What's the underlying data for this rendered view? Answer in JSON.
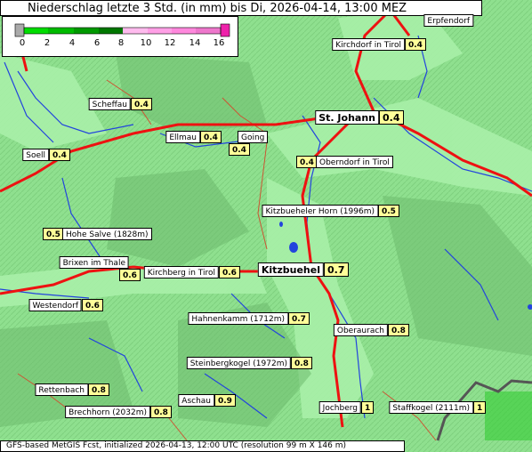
{
  "title": "Niederschlag letzte 3 Std. (in mm) bis Di, 2026-04-14, 13:00 MEZ",
  "legend": {
    "ticks": [
      "0",
      "2",
      "4",
      "6",
      "8",
      "10",
      "12",
      "14",
      "16"
    ],
    "colors": [
      "#aaaaaa",
      "#00cc00",
      "#00aa00",
      "#008800",
      "#ffbbee",
      "#ff88dd",
      "#ee55cc",
      "#ee22aa"
    ]
  },
  "places": [
    {
      "name": "Erpfendorf",
      "value": ""
    },
    {
      "name": "Kirchdorf in Tirol",
      "value": "0.4"
    },
    {
      "name": "Scheffau",
      "value": "0.4"
    },
    {
      "name": "St. Johann",
      "value": "0.4"
    },
    {
      "name": "Ellmau",
      "value": "0.4"
    },
    {
      "name": "Going",
      "value": "0.4"
    },
    {
      "name": "Soell",
      "value": "0.4"
    },
    {
      "name": "Oberndorf in Tirol",
      "value": "0.4"
    },
    {
      "name": "Kitzbueheler Horn (1996m)",
      "value": "0.5"
    },
    {
      "name": "Hohe Salve (1828m)",
      "value": "0.5"
    },
    {
      "name": "Brixen im Thale",
      "value": "0.6"
    },
    {
      "name": "Kirchberg in Tirol",
      "value": "0.6"
    },
    {
      "name": "Kitzbuehel",
      "value": "0.7"
    },
    {
      "name": "Westendorf",
      "value": "0.6"
    },
    {
      "name": "Hahnenkamm (1712m)",
      "value": "0.7"
    },
    {
      "name": "Oberaurach",
      "value": "0.8"
    },
    {
      "name": "Steinbergkogel (1972m)",
      "value": "0.8"
    },
    {
      "name": "Rettenbach",
      "value": "0.8"
    },
    {
      "name": "Aschau",
      "value": "0.9"
    },
    {
      "name": "Brechhorn (2032m)",
      "value": "0.8"
    },
    {
      "name": "Jochberg",
      "value": "1"
    },
    {
      "name": "Staffkogel (2111m)",
      "value": "1"
    }
  ],
  "footer": "GFS-based MetGIS Fcst, initialized 2026-04-13, 12:00 UTC  (resolution 99 m X 146 m)"
}
